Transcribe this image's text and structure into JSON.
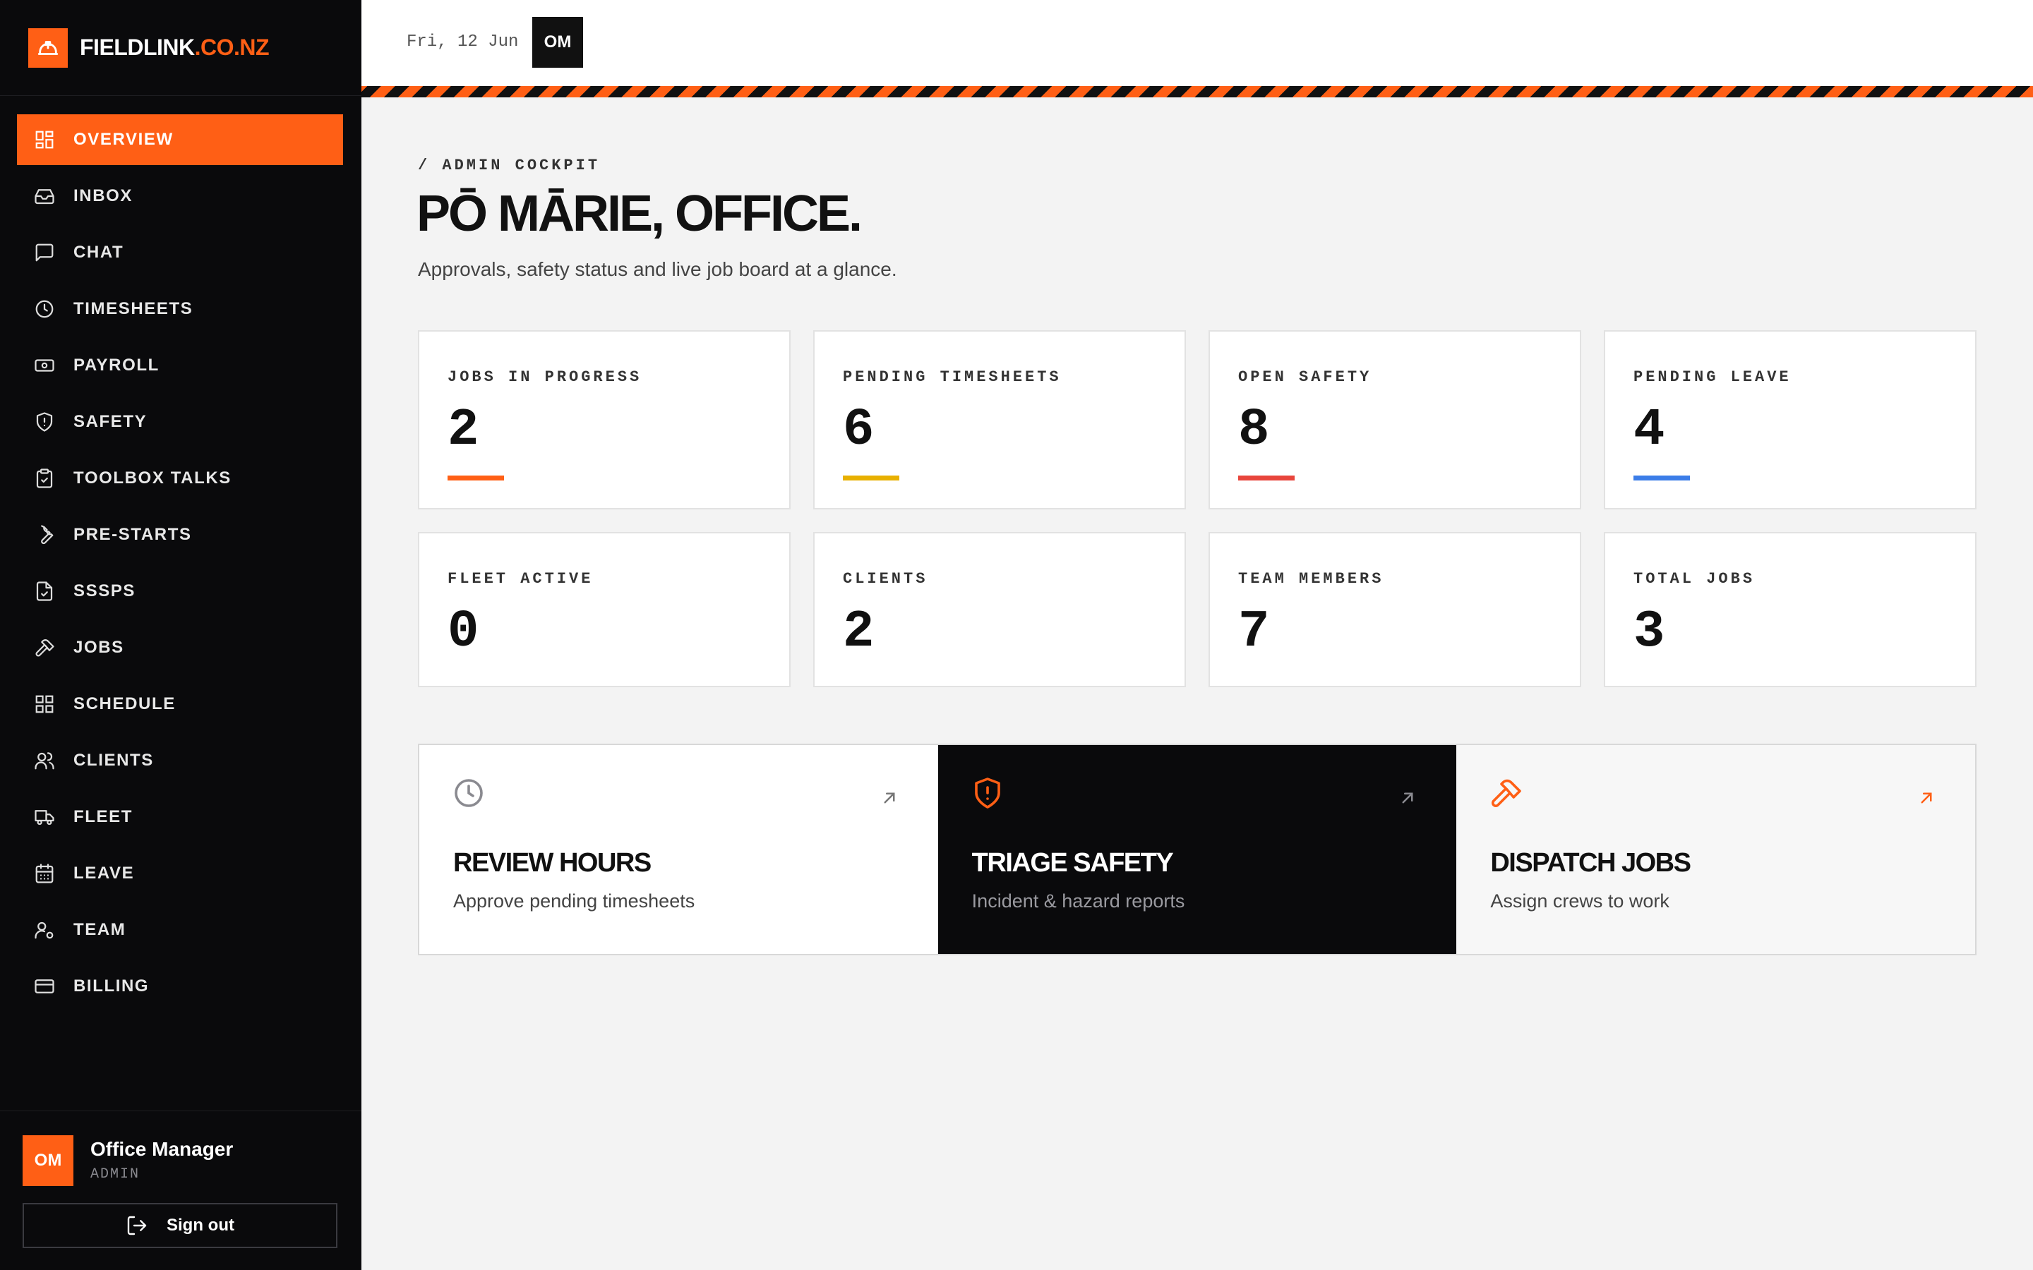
{
  "brand": {
    "name": "FIELDLINK",
    "domain": ".CO.NZ",
    "accent_color": "#ff5f15",
    "logo_icon": "hard-hat-icon"
  },
  "nav": [
    {
      "label": "OVERVIEW",
      "icon": "dashboard-icon",
      "active": true
    },
    {
      "label": "INBOX",
      "icon": "inbox-icon"
    },
    {
      "label": "CHAT",
      "icon": "chat-icon"
    },
    {
      "label": "TIMESHEETS",
      "icon": "clock-icon"
    },
    {
      "label": "PAYROLL",
      "icon": "banknote-icon"
    },
    {
      "label": "SAFETY",
      "icon": "shield-alert-icon"
    },
    {
      "label": "TOOLBOX TALKS",
      "icon": "clipboard-check-icon"
    },
    {
      "label": "PRE-STARTS",
      "icon": "wrench-icon"
    },
    {
      "label": "SSSPS",
      "icon": "file-check-icon"
    },
    {
      "label": "JOBS",
      "icon": "hammer-icon"
    },
    {
      "label": "SCHEDULE",
      "icon": "grid-icon"
    },
    {
      "label": "CLIENTS",
      "icon": "users-icon"
    },
    {
      "label": "FLEET",
      "icon": "truck-icon"
    },
    {
      "label": "LEAVE",
      "icon": "calendar-icon"
    },
    {
      "label": "TEAM",
      "icon": "user-cog-icon"
    },
    {
      "label": "BILLING",
      "icon": "credit-card-icon"
    }
  ],
  "user": {
    "initials": "OM",
    "name": "Office Manager",
    "role": "ADMIN",
    "signout_label": "Sign out"
  },
  "topbar": {
    "date": "Fri, 12 Jun",
    "initials": "OM"
  },
  "page": {
    "eyebrow": "/ ADMIN COCKPIT",
    "title": "PŌ MĀRIE, OFFICE.",
    "subtitle": "Approvals, safety status and live job board at a glance."
  },
  "stats": [
    {
      "label": "JOBS IN PROGRESS",
      "value": "2",
      "color": "#ff5f15"
    },
    {
      "label": "PENDING TIMESHEETS",
      "value": "6",
      "color": "#e8b000"
    },
    {
      "label": "OPEN SAFETY",
      "value": "8",
      "color": "#e8453c"
    },
    {
      "label": "PENDING LEAVE",
      "value": "4",
      "color": "#3b7de8"
    },
    {
      "label": "FLEET ACTIVE",
      "value": "0"
    },
    {
      "label": "CLIENTS",
      "value": "2"
    },
    {
      "label": "TEAM MEMBERS",
      "value": "7"
    },
    {
      "label": "TOTAL JOBS",
      "value": "3"
    }
  ],
  "actions": [
    {
      "title": "REVIEW HOURS",
      "subtitle": "Approve pending timesheets",
      "icon": "clock-icon"
    },
    {
      "title": "TRIAGE SAFETY",
      "subtitle": "Incident & hazard reports",
      "icon": "shield-alert-icon"
    },
    {
      "title": "DISPATCH JOBS",
      "subtitle": "Assign crews to work",
      "icon": "hammer-icon"
    }
  ]
}
